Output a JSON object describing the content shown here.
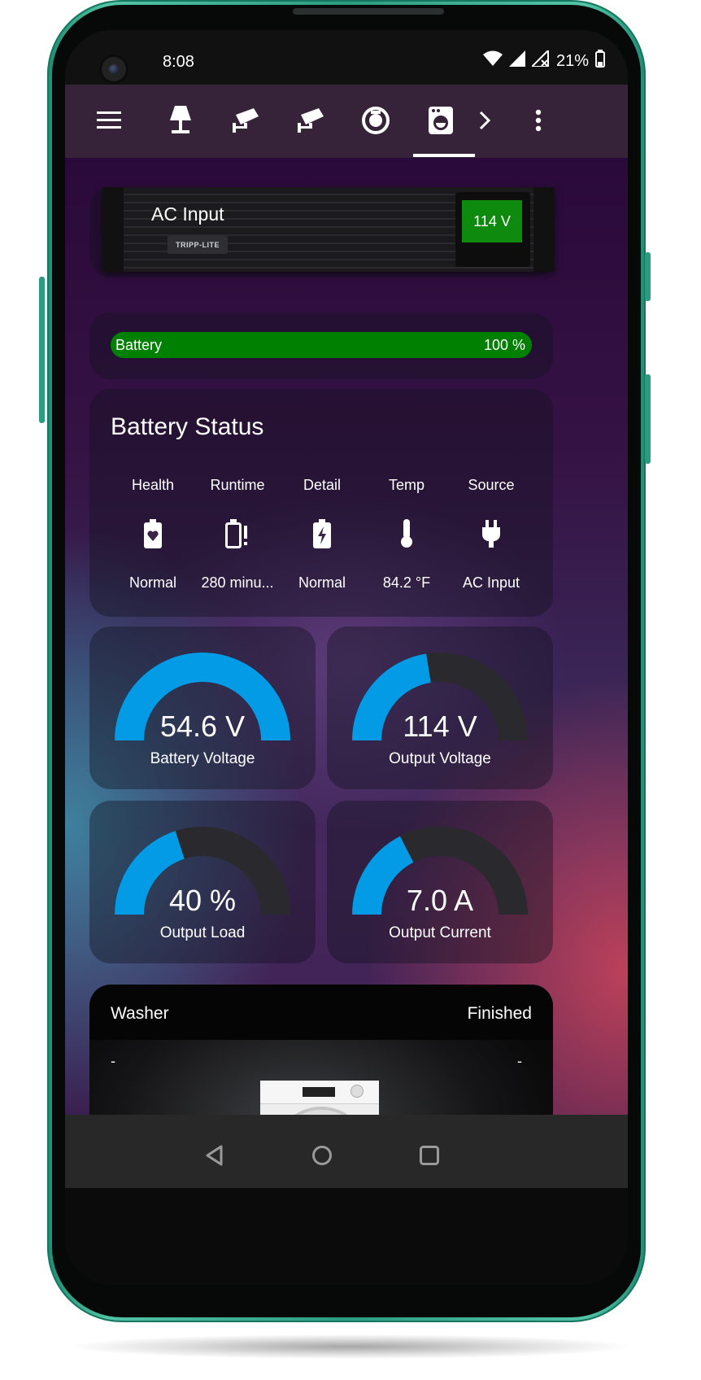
{
  "status_bar": {
    "time": "8:08",
    "battery": "21%"
  },
  "toolbar": {
    "tabs": [
      {
        "icon": "lamp-icon"
      },
      {
        "icon": "cctv-icon"
      },
      {
        "icon": "cctv-icon"
      },
      {
        "icon": "robot-vacuum-icon"
      },
      {
        "icon": "washing-machine-icon",
        "active": true
      }
    ]
  },
  "ups": {
    "label": "AC Input",
    "lcd": "114 V",
    "brand": "TRIPP-LITE"
  },
  "battery_bar": {
    "label": "Battery",
    "value_text": "100 %",
    "percent": 100,
    "color": "#008000"
  },
  "battery_status": {
    "title": "Battery Status",
    "columns": [
      {
        "label": "Health",
        "icon": "battery-heart-icon",
        "value": "Normal"
      },
      {
        "label": "Runtime",
        "icon": "battery-alert-icon",
        "value": "280 minu..."
      },
      {
        "label": "Detail",
        "icon": "battery-charging-icon",
        "value": "Normal"
      },
      {
        "label": "Temp",
        "icon": "thermometer-icon",
        "value": "84.2 °F"
      },
      {
        "label": "Source",
        "icon": "power-plug-icon",
        "value": "AC Input"
      }
    ]
  },
  "gauges": [
    {
      "value": "54.6 V",
      "name": "Battery Voltage",
      "fraction": 1.0
    },
    {
      "value": "114 V",
      "name": "Output Voltage",
      "fraction": 0.45
    },
    {
      "value": "40 %",
      "name": "Output Load",
      "fraction": 0.4
    },
    {
      "value": "7.0 A",
      "name": "Output Current",
      "fraction": 0.35
    }
  ],
  "gauge_colors": {
    "fill": "#039be5",
    "track": "#2a2a2e"
  },
  "washer": {
    "title": "Washer",
    "status": "Finished",
    "left_dash": "-",
    "right_dash": "-"
  }
}
